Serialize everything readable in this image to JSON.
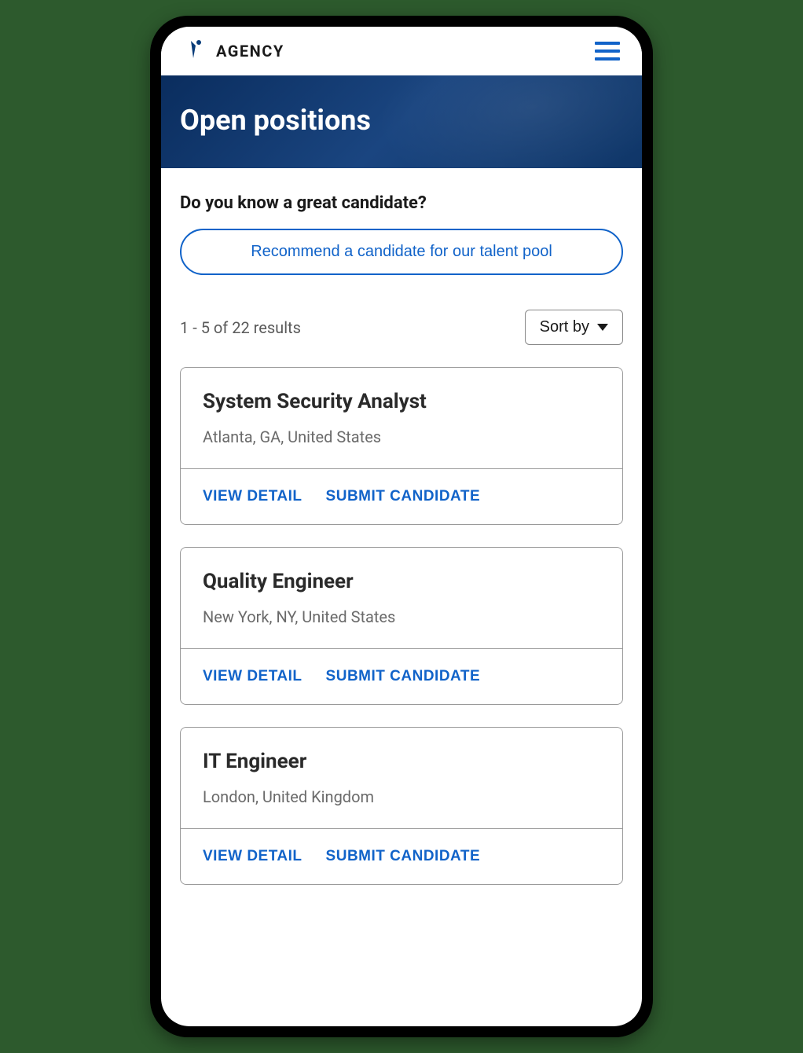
{
  "header": {
    "brand": "AGENCY"
  },
  "hero": {
    "title": "Open positions"
  },
  "prompt": {
    "heading": "Do you know a great candidate?",
    "recommend_label": "Recommend a candidate for our talent pool"
  },
  "results": {
    "count_text": "1 - 5 of 22 results",
    "sort_label": "Sort by"
  },
  "actions": {
    "view_detail": "VIEW DETAIL",
    "submit_candidate": "SUBMIT CANDIDATE"
  },
  "jobs": [
    {
      "title": "System Security Analyst",
      "location": "Atlanta, GA, United States"
    },
    {
      "title": "Quality Engineer",
      "location": "New York, NY, United States"
    },
    {
      "title": "IT Engineer",
      "location": "London, United Kingdom"
    }
  ]
}
